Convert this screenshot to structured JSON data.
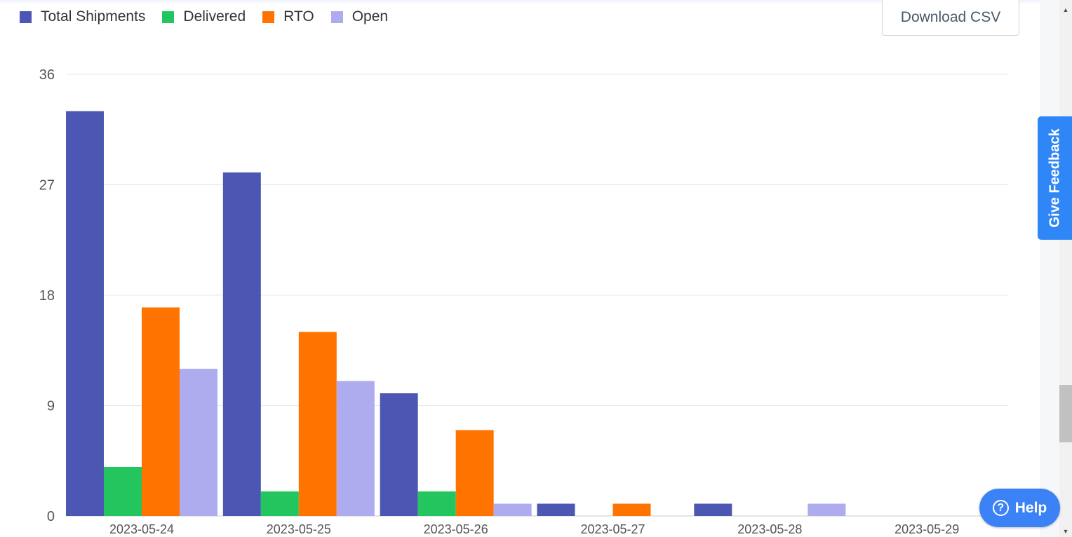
{
  "legend": {
    "items": [
      {
        "label": "Total Shipments",
        "color": "#4c56b3"
      },
      {
        "label": "Delivered",
        "color": "#22c55e"
      },
      {
        "label": "RTO",
        "color": "#ff7300"
      },
      {
        "label": "Open",
        "color": "#afabef"
      }
    ]
  },
  "toolbar": {
    "download_label": "Download CSV"
  },
  "feedback": {
    "label": "Give Feedback"
  },
  "help": {
    "label": "Help",
    "icon": "question-circle-icon"
  },
  "chart_data": {
    "type": "bar",
    "categories": [
      "2023-05-24",
      "2023-05-25",
      "2023-05-26",
      "2023-05-27",
      "2023-05-28",
      "2023-05-29"
    ],
    "series": [
      {
        "name": "Total Shipments",
        "color": "#4c56b3",
        "values": [
          33,
          28,
          10,
          1,
          1,
          0
        ]
      },
      {
        "name": "Delivered",
        "color": "#22c55e",
        "values": [
          4,
          2,
          2,
          0,
          0,
          0
        ]
      },
      {
        "name": "RTO",
        "color": "#ff7300",
        "values": [
          17,
          15,
          7,
          1,
          0,
          0
        ]
      },
      {
        "name": "Open",
        "color": "#afabef",
        "values": [
          12,
          11,
          1,
          0,
          1,
          0
        ]
      }
    ],
    "yticks": [
      "0",
      "9",
      "18",
      "27",
      "36"
    ],
    "ylim": [
      0,
      36
    ],
    "grid": true,
    "legend_position": "top-left"
  }
}
